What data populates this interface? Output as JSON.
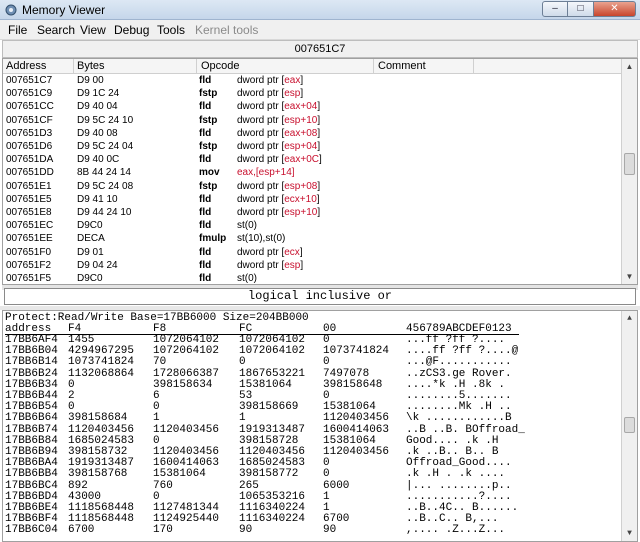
{
  "window": {
    "title": "Memory Viewer",
    "minimize": "–",
    "maximize": "□",
    "close": "✕"
  },
  "menu": [
    "File",
    "Search",
    "View",
    "Debug",
    "Tools",
    "Kernel tools"
  ],
  "address_bar": "007651C7",
  "disasm": {
    "columns": [
      "Address",
      "Bytes",
      "Opcode",
      "Comment"
    ],
    "rows": [
      {
        "addr": "007651C7",
        "bytes": "D9 00",
        "op": "fld",
        "pre": "dword ptr [",
        "reg": "eax",
        "post": "]"
      },
      {
        "addr": "007651C9",
        "bytes": "D9 1C 24",
        "op": "fstp",
        "pre": "dword ptr [",
        "reg": "esp",
        "post": "]"
      },
      {
        "addr": "007651CC",
        "bytes": "D9 40 04",
        "op": "fld",
        "pre": "dword ptr [",
        "reg": "eax+04",
        "post": "]"
      },
      {
        "addr": "007651CF",
        "bytes": "D9 5C 24 10",
        "op": "fstp",
        "pre": "dword ptr [",
        "reg": "esp+10",
        "post": "]"
      },
      {
        "addr": "007651D3",
        "bytes": "D9 40 08",
        "op": "fld",
        "pre": "dword ptr [",
        "reg": "eax+08",
        "post": "]"
      },
      {
        "addr": "007651D6",
        "bytes": "D9 5C 24 04",
        "op": "fstp",
        "pre": "dword ptr [",
        "reg": "esp+04",
        "post": "]"
      },
      {
        "addr": "007651DA",
        "bytes": "D9 40 0C",
        "op": "fld",
        "pre": "dword ptr [",
        "reg": "eax+0C",
        "post": "]"
      },
      {
        "addr": "007651DD",
        "bytes": "8B 44 24 14",
        "op": "mov",
        "pre": "",
        "reg": "eax,[esp+14]",
        "post": ""
      },
      {
        "addr": "007651E1",
        "bytes": "D9 5C 24 08",
        "op": "fstp",
        "pre": "dword ptr [",
        "reg": "esp+08",
        "post": "]"
      },
      {
        "addr": "007651E5",
        "bytes": "D9 41 10",
        "op": "fld",
        "pre": "dword ptr [",
        "reg": "ecx+10",
        "post": "]"
      },
      {
        "addr": "007651E8",
        "bytes": "D9 44 24 10",
        "op": "fld",
        "pre": "dword ptr [",
        "reg": "esp+10",
        "post": "]"
      },
      {
        "addr": "007651EC",
        "bytes": "D9C0",
        "op": "fld",
        "pre": "st(0)",
        "reg": "",
        "post": ""
      },
      {
        "addr": "007651EE",
        "bytes": "DECA",
        "op": "fmulp",
        "pre": "st(10),st(0)",
        "reg": "",
        "post": ""
      },
      {
        "addr": "007651F0",
        "bytes": "D9 01",
        "op": "fld",
        "pre": "dword ptr [",
        "reg": "ecx",
        "post": "]"
      },
      {
        "addr": "007651F2",
        "bytes": "D9 04 24",
        "op": "fld",
        "pre": "dword ptr [",
        "reg": "esp",
        "post": "]"
      },
      {
        "addr": "007651F5",
        "bytes": "D9C0",
        "op": "fld",
        "pre": "st(0)",
        "reg": "",
        "post": ""
      }
    ]
  },
  "opcode_description": "logical inclusive or",
  "hexview": {
    "info": "Protect:Read/Write  Base=17BB6000 Size=204BB000",
    "header": [
      "address",
      "F4",
      "F8",
      "FC",
      "00",
      "456789ABCDEF0123"
    ],
    "rows": [
      [
        "17BB6AF4",
        "1455",
        "1072064102",
        "1072064102",
        "0",
        "...ff ?ff ?...."
      ],
      [
        "17BB6B04",
        "4294967295",
        "1072064102",
        "1072064102",
        "1073741824",
        "....ff ?ff ?....@"
      ],
      [
        "17BB6B14",
        "1073741824",
        "70",
        "0",
        "0",
        "...@F..........."
      ],
      [
        "17BB6B24",
        "1132068864",
        "1728066387",
        "1867653221",
        "7497078",
        "..zCS3.ge Rover."
      ],
      [
        "17BB6B34",
        "0",
        "398158634",
        "15381064",
        "398158648",
        "....*k .H  .8k ."
      ],
      [
        "17BB6B44",
        "2",
        "6",
        "53",
        "0",
        "........5......."
      ],
      [
        "17BB6B54",
        "0",
        "0",
        "398158669",
        "15381064",
        "........Mk .H .."
      ],
      [
        "17BB6B64",
        "398158684",
        "1",
        "1",
        "1120403456",
        "\\k ............B"
      ],
      [
        "17BB6B74",
        "1120403456",
        "1120403456",
        "1919313487",
        "1600414063",
        "..B ..B. BOffroad_"
      ],
      [
        "17BB6B84",
        "1685024583",
        "0",
        "398158728",
        "15381064",
        "Good.... .k .H"
      ],
      [
        "17BB6B94",
        "398158732",
        "1120403456",
        "1120403456",
        "1120403456",
        ".k ..B.. B.. B"
      ],
      [
        "17BB6BA4",
        "1919313487",
        "1600414063",
        "1685024583",
        "0",
        "Offroad_Good...."
      ],
      [
        "17BB6BB4",
        "398158768",
        "15381064",
        "398158772",
        "0",
        ".k .H . .k ...."
      ],
      [
        "17BB6BC4",
        "892",
        "760",
        "265",
        "6000",
        "|... ........p.."
      ],
      [
        "17BB6BD4",
        "43000",
        "0",
        "1065353216",
        "1",
        "...........?...."
      ],
      [
        "17BB6BE4",
        "1118568448",
        "1127481344",
        "1116340224",
        "1",
        "..B..4C.. B......"
      ],
      [
        "17BB6BF4",
        "1118568448",
        "1124925440",
        "1116340224",
        "6700",
        "..B..C.. B,..."
      ],
      [
        "17BB6C04",
        "6700",
        "170",
        "90",
        "90",
        ",.... .Z...Z..."
      ]
    ]
  },
  "icons": {
    "app": "gear-icon",
    "scroll_up": "▲",
    "scroll_down": "▼"
  }
}
